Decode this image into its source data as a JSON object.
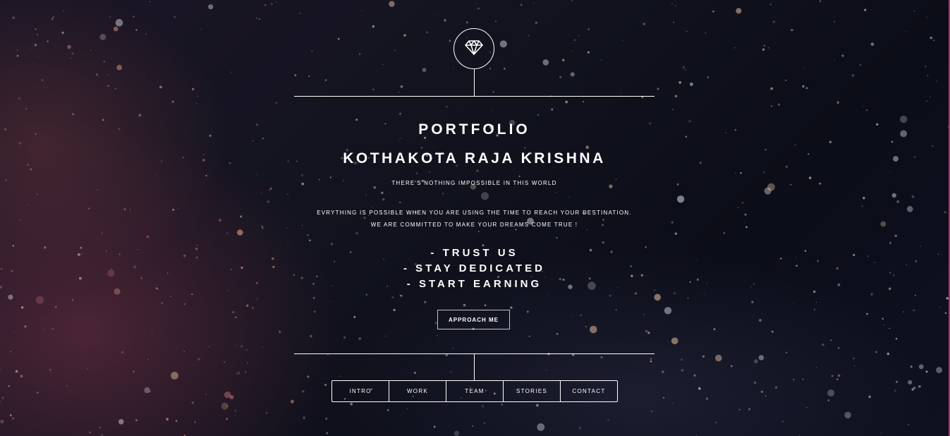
{
  "header": {
    "logo_icon": "diamond-icon"
  },
  "intro": {
    "title": "PORTFOLIO",
    "name": "KOTHAKOTA RAJA KRISHNA",
    "tagline": "THERE'S NOTHING IMPOSSIBLE IN THIS WORLD",
    "description_line1": "EVRYTHING IS POSSIBLE WHEN YOU ARE USING THE TIME TO REACH YOUR DESTINATION.",
    "description_line2": "WE ARE COMMITTED TO MAKE YOUR DREAMS COME TRUE !",
    "motto": [
      "- TRUST US",
      "- STAY DEDICATED",
      "- START EARNING"
    ],
    "cta_label": "APPROACH ME"
  },
  "nav": {
    "items": [
      {
        "label": "INTRO"
      },
      {
        "label": "WORK"
      },
      {
        "label": "TEAM"
      },
      {
        "label": "STORIES"
      },
      {
        "label": "CONTACT"
      }
    ]
  },
  "colors": {
    "background": "#0d0f1c",
    "text": "#ffffff",
    "right_edge_accent": "#b0306a"
  }
}
